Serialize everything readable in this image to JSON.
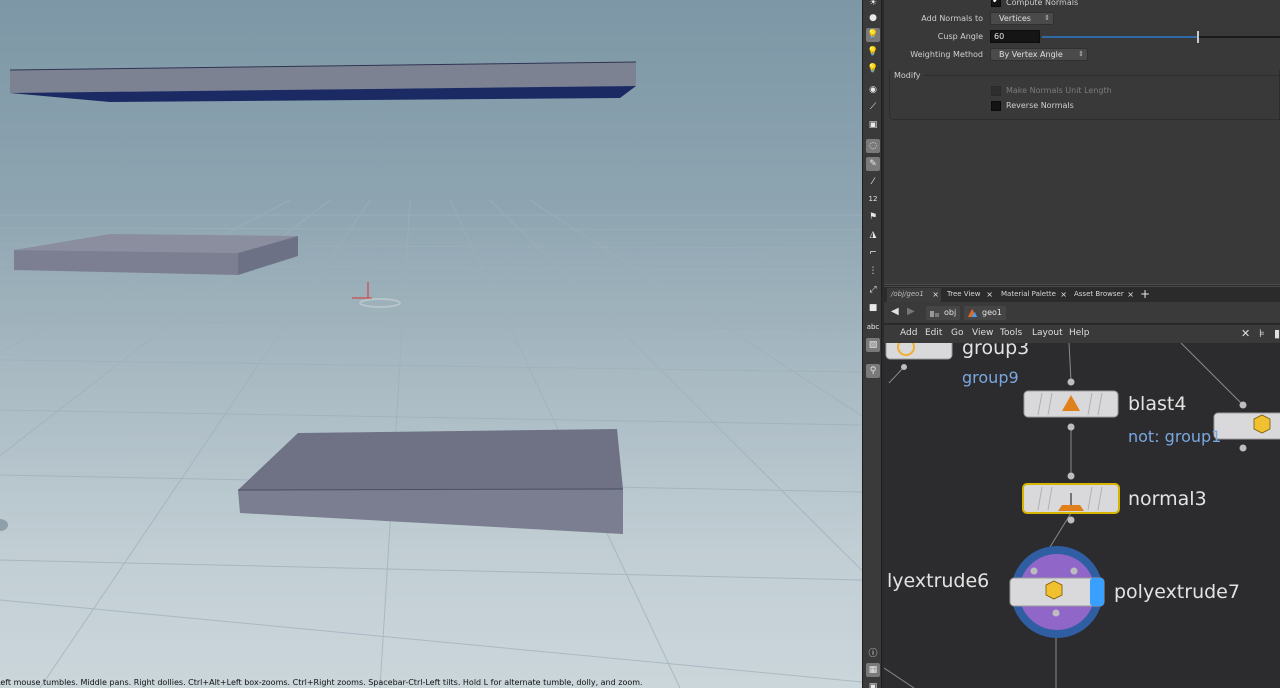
{
  "viewport": {
    "hint_text": "Left mouse tumbles. Middle pans. Right dollies. Ctrl+Alt+Left box-zooms. Ctrl+Right zooms. Spacebar-Ctrl-Left tilts. Hold L for alternate tumble, dolly, and zoom."
  },
  "shelf": {
    "tools": [
      "light-icon",
      "sphere-icon",
      "light-bulb-icon",
      "light-bulb-icon",
      "light-bulb-icon",
      "camera-icon",
      "ruler-icon",
      "camera-rig-icon",
      "select-icon",
      "brush-icon",
      "eyedropper-icon",
      "count-icon",
      "flag-icon",
      "measure-icon",
      "bend-icon",
      "grid-icon",
      "joint-icon",
      "box-icon",
      "text-icon",
      "image-icon",
      "pin-icon"
    ],
    "text_tool_label": "abc",
    "count_tool_label": "12",
    "info_icon": "info-icon",
    "layout_icon": "layout-icon"
  },
  "params": {
    "compute_normals_label": "Compute Normals",
    "compute_normals_checked": true,
    "add_normals_label": "Add Normals to",
    "add_normals_value": "Vertices",
    "cusp_angle_label": "Cusp Angle",
    "cusp_angle_value": "60",
    "weighting_label": "Weighting Method",
    "weighting_value": "By Vertex Angle",
    "modify_label": "Modify",
    "unit_length_label": "Make Normals Unit Length",
    "reverse_label": "Reverse Normals"
  },
  "tabs": [
    {
      "label": "/obj/geo1",
      "active": true
    },
    {
      "label": "Tree View",
      "active": false
    },
    {
      "label": "Material Palette",
      "active": false
    },
    {
      "label": "Asset Browser",
      "active": false
    }
  ],
  "tab_add": "+",
  "tab_close": "×",
  "pathbar": {
    "back": "◀",
    "forward": "▶",
    "crumbs": [
      "obj",
      "geo1"
    ]
  },
  "menubar": {
    "items": [
      "Add",
      "Edit",
      "Go",
      "View",
      "Tools",
      "Layout",
      "Help"
    ]
  },
  "network": {
    "nodes": {
      "group3": "group3",
      "group9": "group9",
      "blast4": "blast4",
      "blast4_sub": "not: group1",
      "normal3": "normal3",
      "polyextrude6": "lyextrude6",
      "polyextrude7": "polyextrude7"
    }
  },
  "colors": {
    "accent_blue": "#3aa0ff",
    "node_label_blue": "#7aa7e0",
    "selected_outline": "#d6b400"
  }
}
